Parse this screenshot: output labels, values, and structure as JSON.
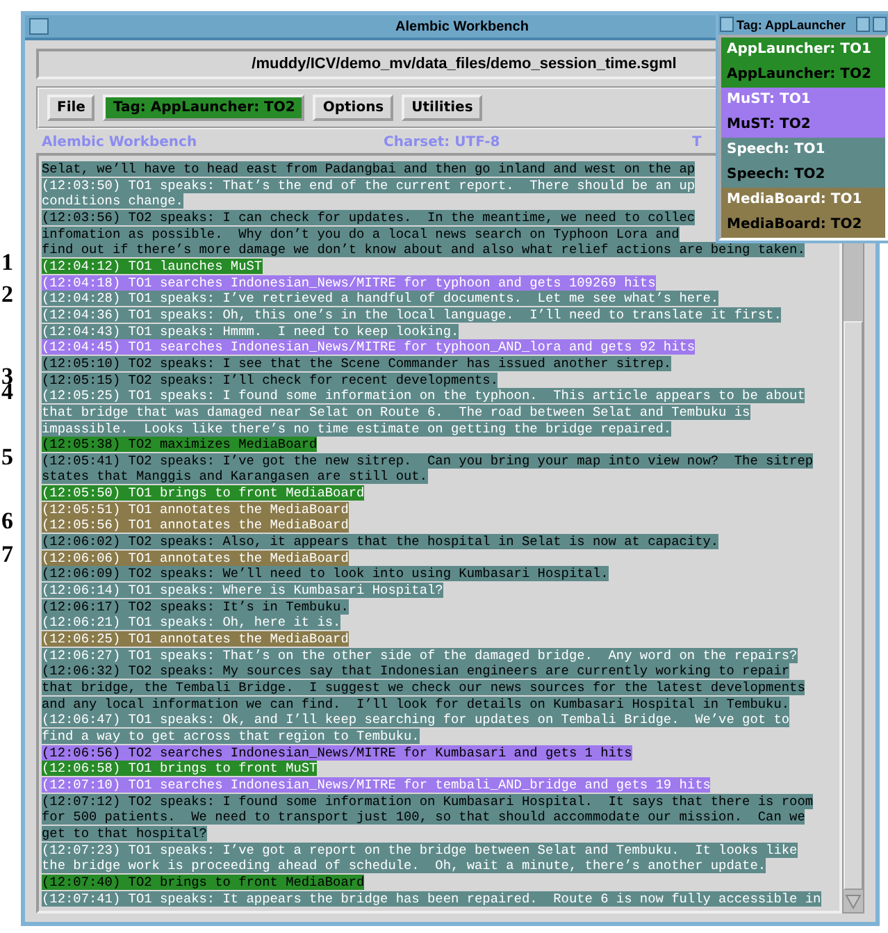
{
  "window": {
    "title": "Alembic Workbench"
  },
  "file_path": "/muddy/ICV/demo_mv/data_files/demo_session_time.sgml",
  "toolbar": [
    {
      "label": "File",
      "kind": "plain"
    },
    {
      "label": "Tag: AppLauncher: TO2",
      "kind": "applauncher-to2"
    },
    {
      "label": "Options",
      "kind": "plain"
    },
    {
      "label": "Utilities",
      "kind": "plain"
    }
  ],
  "status": {
    "app": "Alembic Workbench",
    "charset": "Charset: UTF-8",
    "column_3": "T"
  },
  "log": [
    {
      "kind": "speech-to2",
      "lines": [
        "Selat, we’ll have to head east from Padangbai and then go inland and west on the ap"
      ]
    },
    {
      "kind": "speech-to1",
      "lines": [
        "(12:03:50) TO1 speaks: That’s the end of the current report.  There should be an up",
        "conditions change."
      ]
    },
    {
      "kind": "speech-to2",
      "lines": [
        "(12:03:56) TO2 speaks: I can check for updates.  In the meantime, we need to collec",
        "infomation as possible.  Why don’t you do a local news search on Typhoon Lora and",
        "find out if there’s more damage we don’t know about and also what relief actions are being taken."
      ]
    },
    {
      "kind": "applauncher-to1",
      "marker": "1",
      "lines": [
        "(12:04:12) TO1 launches MuST"
      ]
    },
    {
      "kind": "must-to1",
      "lines": [
        "(12:04:18) TO1 searches Indonesian_News/MITRE for typhoon and gets 109269 hits"
      ]
    },
    {
      "kind": "speech-to1",
      "marker": "2",
      "lines": [
        "(12:04:28) TO1 speaks: I’ve retrieved a handful of documents.  Let me see what’s here."
      ]
    },
    {
      "kind": "speech-to1",
      "lines": [
        "(12:04:36) TO1 speaks: Oh, this one’s in the local language.  I’ll need to translate it first."
      ]
    },
    {
      "kind": "speech-to1",
      "lines": [
        "(12:04:43) TO1 speaks: Hmmm.  I need to keep looking."
      ]
    },
    {
      "kind": "must-to1",
      "lines": [
        "(12:04:45) TO1 searches Indonesian_News/MITRE for typhoon_AND_lora and gets 92 hits"
      ]
    },
    {
      "kind": "speech-to2",
      "lines": [
        "(12:05:10) TO2 speaks: I see that the Scene Commander has issued another sitrep."
      ]
    },
    {
      "kind": "speech-to2",
      "marker": "3",
      "lines": [
        "(12:05:15) TO2 speaks: I’ll check for recent developments."
      ]
    },
    {
      "kind": "speech-to1",
      "marker": "4",
      "lines": [
        "(12:05:25) TO1 speaks: I found some information on the typhoon.  This article appears to be about",
        "that bridge that was damaged near Selat on Route 6.  The road between Selat and Tembuku is",
        "impassible.  Looks like there’s no time estimate on getting the bridge repaired."
      ]
    },
    {
      "kind": "applauncher-to2",
      "lines": [
        "(12:05:38) TO2 maximizes MediaBoard"
      ]
    },
    {
      "kind": "speech-to2",
      "marker": "5",
      "lines": [
        "(12:05:41) TO2 speaks: I’ve got the new sitrep.  Can you bring your map into view now?  The sitrep",
        "states that Manggis and Karangasen are still out."
      ]
    },
    {
      "kind": "applauncher-to1",
      "lines": [
        "(12:05:50) TO1 brings to front MediaBoard"
      ]
    },
    {
      "kind": "mediaboard-to1",
      "lines": [
        "(12:05:51) TO1 annotates the MediaBoard"
      ]
    },
    {
      "kind": "mediaboard-to1",
      "marker": "6",
      "lines": [
        "(12:05:56) TO1 annotates the MediaBoard"
      ]
    },
    {
      "kind": "speech-to2",
      "lines": [
        "(12:06:02) TO2 speaks: Also, it appears that the hospital in Selat is now at capacity."
      ]
    },
    {
      "kind": "mediaboard-to1",
      "marker": "7",
      "lines": [
        "(12:06:06) TO1 annotates the MediaBoard"
      ]
    },
    {
      "kind": "speech-to2",
      "lines": [
        "(12:06:09) TO2 speaks: We’ll need to look into using Kumbasari Hospital."
      ]
    },
    {
      "kind": "speech-to1",
      "lines": [
        "(12:06:14) TO1 speaks: Where is Kumbasari Hospital?"
      ]
    },
    {
      "kind": "speech-to2",
      "lines": [
        "(12:06:17) TO2 speaks: It’s in Tembuku."
      ]
    },
    {
      "kind": "speech-to1",
      "lines": [
        "(12:06:21) TO1 speaks: Oh, here it is."
      ]
    },
    {
      "kind": "mediaboard-to1",
      "lines": [
        "(12:06:25) TO1 annotates the MediaBoard"
      ]
    },
    {
      "kind": "speech-to1",
      "lines": [
        "(12:06:27) TO1 speaks: That’s on the other side of the damaged bridge.  Any word on the repairs?"
      ]
    },
    {
      "kind": "speech-to2",
      "lines": [
        "(12:06:32) TO2 speaks: My sources say that Indonesian engineers are currently working to repair",
        "that bridge, the Tembali Bridge.  I suggest we check our news sources for the latest developments",
        "and any local information we can find.  I’ll look for details on Kumbasari Hospital in Tembuku."
      ]
    },
    {
      "kind": "speech-to1",
      "lines": [
        "(12:06:47) TO1 speaks: Ok, and I’ll keep searching for updates on Tembali Bridge.  We’ve got to",
        "find a way to get across that region to Tembuku."
      ]
    },
    {
      "kind": "must-to2",
      "lines": [
        "(12:06:56) TO2 searches Indonesian_News/MITRE for Kumbasari and gets 1 hits"
      ]
    },
    {
      "kind": "applauncher-to1",
      "lines": [
        "(12:06:58) TO1 brings to front MuST"
      ]
    },
    {
      "kind": "must-to1",
      "lines": [
        "(12:07:10) TO1 searches Indonesian_News/MITRE for tembali_AND_bridge and gets 19 hits"
      ]
    },
    {
      "kind": "speech-to2",
      "lines": [
        "(12:07:12) TO2 speaks: I found some information on Kumbasari Hospital.  It says that there is room",
        "for 500 patients.  We need to transport just 100, so that should accommodate our mission.  Can we",
        "get to that hospital?"
      ]
    },
    {
      "kind": "speech-to1",
      "lines": [
        "(12:07:23) TO1 speaks: I’ve got a report on the bridge between Selat and Tembuku.  It looks like",
        "the bridge work is proceeding ahead of schedule.  Oh, wait a minute, there’s another update."
      ]
    },
    {
      "kind": "applauncher-to2",
      "lines": [
        "(12:07:40) TO2 brings to front MediaBoard"
      ]
    },
    {
      "kind": "speech-to1",
      "lines": [
        "(12:07:41) TO1 speaks: It appears the bridge has been repaired.  Route 6 is now fully accessible in"
      ]
    }
  ],
  "tag_menu": {
    "title": "Tag: AppLauncher",
    "items": [
      {
        "label": "AppLauncher: TO1",
        "kind": "applauncher-to1"
      },
      {
        "label": "AppLauncher: TO2",
        "kind": "applauncher-to2"
      },
      {
        "label": "MuST: TO1",
        "kind": "must-to1"
      },
      {
        "label": "MuST: TO2",
        "kind": "must-to2"
      },
      {
        "label": "Speech: TO1",
        "kind": "speech-to1"
      },
      {
        "label": "Speech: TO2",
        "kind": "speech-to2"
      },
      {
        "label": "MediaBoard: TO1",
        "kind": "mediaboard-to1"
      },
      {
        "label": "MediaBoard: TO2",
        "kind": "mediaboard-to2"
      }
    ]
  }
}
